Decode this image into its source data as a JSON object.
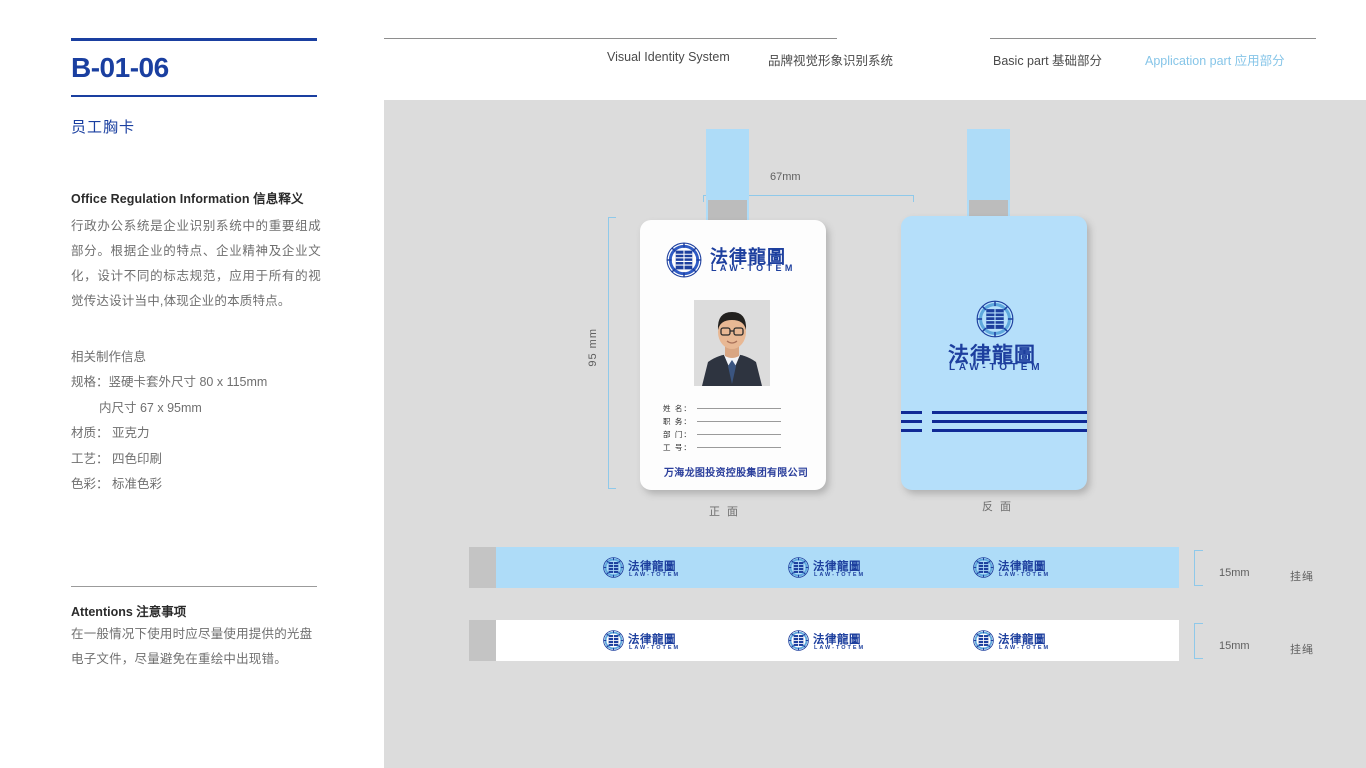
{
  "sidebar": {
    "doc_code": "B-01-06",
    "doc_subtitle": "员工胸卡",
    "info_heading": "Office Regulation Information  信息释义",
    "info_body": "行政办公系统是企业识别系统中的重要组成部分。根据企业的特点、企业精神及企业文化，设计不同的标志规范，应用于所有的视觉传达设计当中,体现企业的本质特点。",
    "spec_title": "相关制作信息",
    "spec_rows": [
      "规格：竖硬卡套外尺寸  80 x 115mm",
      "内尺寸 67 x 95mm",
      "材质： 亚克力",
      "工艺： 四色印刷",
      "色彩： 标准色彩"
    ],
    "attentions_heading": "Attentions 注意事项",
    "attentions_body": "在一般情况下使用时应尽量使用提供的光盘电子文件，尽量避免在重绘中出现错。"
  },
  "header": {
    "visual_identity_en": "Visual Identity System",
    "visual_identity_cn": "品牌视觉形象识别系统",
    "basic_part": "Basic part  基础部分",
    "application_part": "Application part  应用部分"
  },
  "canvas": {
    "front_card": {
      "caption": "正 面",
      "logo_cn": "法律龍圖",
      "logo_en": "LAW-TOTEM",
      "fields": [
        {
          "label": "姓 名："
        },
        {
          "label": "职 务："
        },
        {
          "label": "部 门："
        },
        {
          "label": "工 号："
        }
      ],
      "company_name": "万海龙图投资控股集团有限公司"
    },
    "back_card": {
      "caption": "反 面",
      "logo_cn": "法律龍圖",
      "logo_en": "LAW-TOTEM"
    },
    "dimensions": {
      "width_label": "67mm",
      "height_label": "95 mm"
    },
    "lanyards": [
      {
        "size_label": "15mm",
        "name_label": "挂绳",
        "logo_cn": "法律龍圖",
        "logo_en": "LAW-TOTEM",
        "variant": "blue"
      },
      {
        "size_label": "15mm",
        "name_label": "挂绳",
        "logo_cn": "法律龍圖",
        "logo_en": "LAW-TOTEM",
        "variant": "white"
      }
    ]
  },
  "colors": {
    "brand_blue": "#1a3fa0",
    "logo_blue": "#1d3f9e",
    "accent_light_blue": "#aedcf8",
    "canvas_gray": "#dcdcdc",
    "header_link_blue": "#86c5e8"
  }
}
